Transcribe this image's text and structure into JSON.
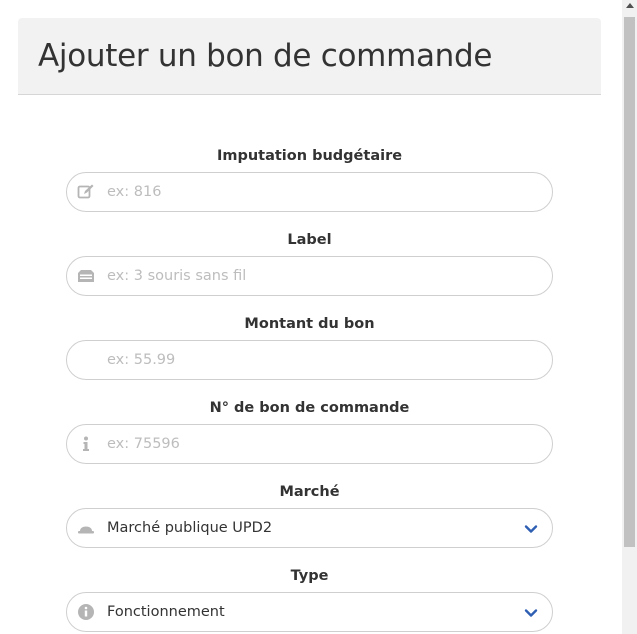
{
  "modal": {
    "title": "Ajouter un bon de commande"
  },
  "form": {
    "fields": [
      {
        "label": "Imputation budgétaire",
        "placeholder": "ex: 816",
        "icon": "edit-icon"
      },
      {
        "label": "Label",
        "placeholder": "ex: 3 souris sans fil",
        "icon": "archive-icon"
      },
      {
        "label": "Montant du bon",
        "placeholder": "ex: 55.99",
        "icon": "euro-icon"
      },
      {
        "label": "N° de bon de commande",
        "placeholder": "ex: 75596",
        "icon": "info-icon"
      },
      {
        "label": "Marché",
        "value": "Marché publique UPD2",
        "icon": "hat-icon"
      },
      {
        "label": "Type",
        "value": "Fonctionnement",
        "icon": "info-circle-icon"
      }
    ]
  },
  "colors": {
    "header_bg": "#f2f2f2",
    "chevron": "#2f5fb3",
    "icon": "#b5b5b5"
  }
}
